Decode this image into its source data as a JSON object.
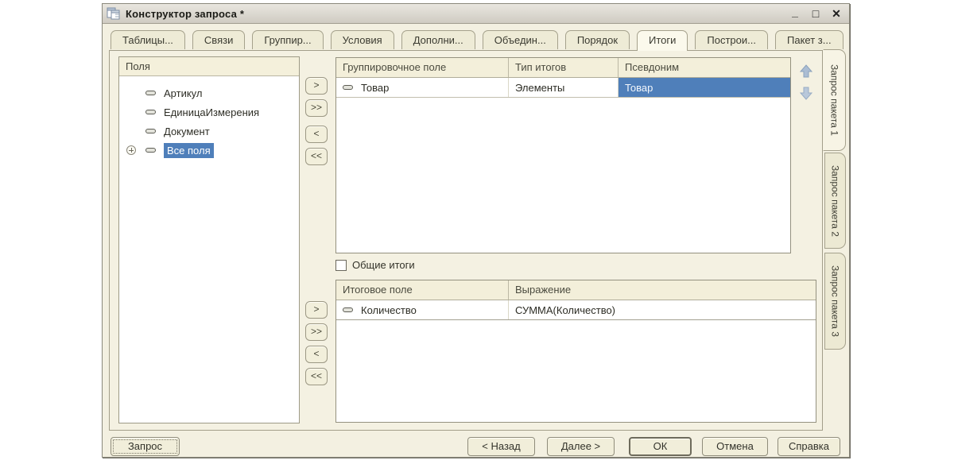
{
  "titlebar": {
    "title": "Конструктор запроса *",
    "minimize_glyph": "_",
    "maximize_glyph": "□",
    "close_glyph": "✕"
  },
  "tabs": [
    {
      "label": "Таблицы...",
      "active": false
    },
    {
      "label": "Связи",
      "active": false
    },
    {
      "label": "Группир...",
      "active": false
    },
    {
      "label": "Условия",
      "active": false
    },
    {
      "label": "Дополни...",
      "active": false
    },
    {
      "label": "Объедин...",
      "active": false
    },
    {
      "label": "Порядок",
      "active": false
    },
    {
      "label": "Итоги",
      "active": true
    },
    {
      "label": "Построи...",
      "active": false
    },
    {
      "label": "Пакет з...",
      "active": false
    }
  ],
  "fields_panel": {
    "title": "Поля",
    "items": [
      {
        "label": "Артикул",
        "selected": false,
        "expandable": false
      },
      {
        "label": "ЕдиницаИзмерения",
        "selected": false,
        "expandable": false
      },
      {
        "label": "Документ",
        "selected": false,
        "expandable": false
      },
      {
        "label": "Все поля",
        "selected": true,
        "expandable": true
      }
    ]
  },
  "transfer": {
    "add": ">",
    "add_all": ">>",
    "remove": "<",
    "remove_all": "<<"
  },
  "grouping_table": {
    "columns": [
      "Группировочное поле",
      "Тип итогов",
      "Псевдоним"
    ],
    "rows": [
      {
        "field": "Товар",
        "total_type": "Элементы",
        "alias": "Товар",
        "alias_selected": true
      }
    ]
  },
  "general_totals": {
    "label": "Общие итоги",
    "checked": false
  },
  "totals_table": {
    "columns": [
      "Итоговое поле",
      "Выражение"
    ],
    "rows": [
      {
        "field": "Количество",
        "expression": "СУММА(Количество)"
      }
    ]
  },
  "package_tabs": [
    {
      "label": "Запрос пакета 1",
      "active": true
    },
    {
      "label": "Запрос пакета 2",
      "active": false
    },
    {
      "label": "Запрос пакета 3",
      "active": false
    }
  ],
  "footer": {
    "query": "Запрос",
    "back": "< Назад",
    "next": "Далее >",
    "ok": "ОК",
    "cancel": "Отмена",
    "help": "Справка"
  },
  "colors": {
    "selection_blue": "#4f7fba",
    "dialog_bg": "#f3f0e1",
    "tab_bg": "#eeebd6",
    "active_tab_bg": "#fbf9ec",
    "table_header_bg": "#f3efda",
    "arrow_blue": "#abbdd3"
  }
}
